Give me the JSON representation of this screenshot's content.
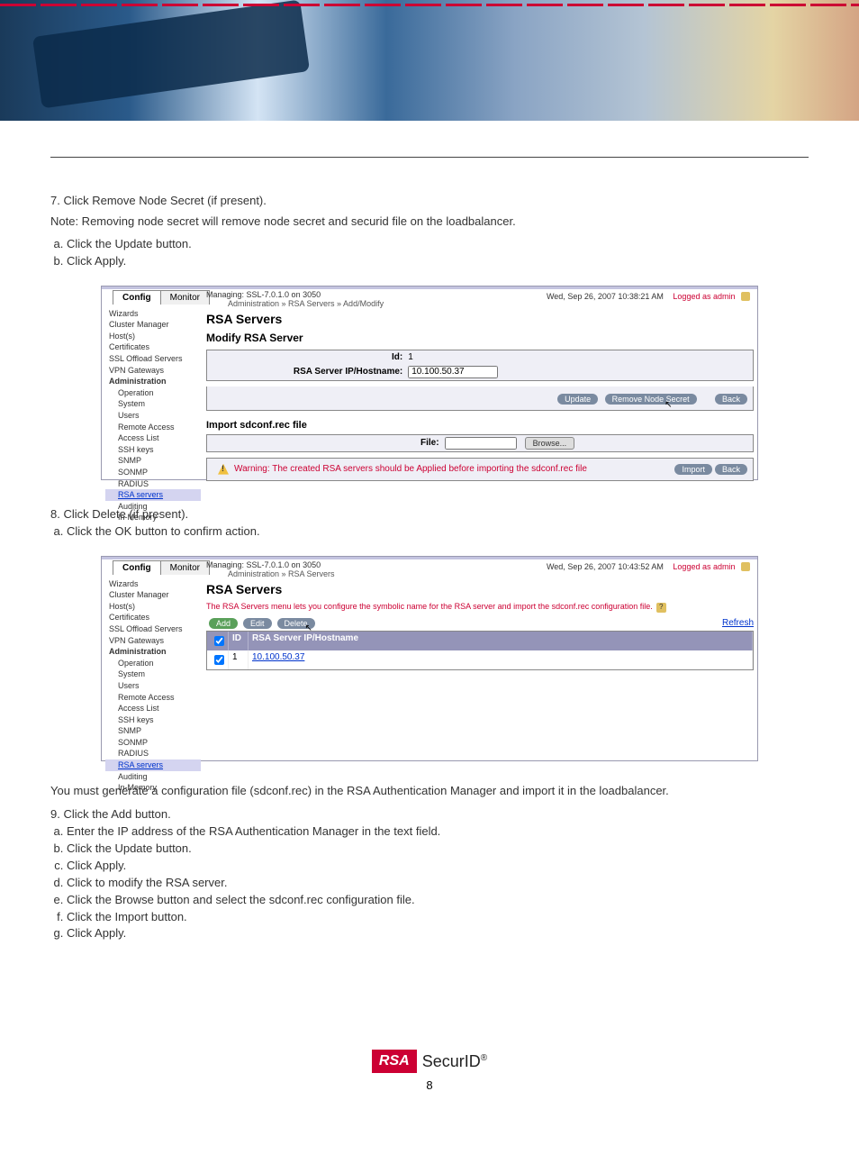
{
  "doc": {
    "step7": "7. Click Remove Node Secret (if present).",
    "note7": "Note: Removing node secret will remove node secret and securid file on the loadbalancer.",
    "list7": [
      "Click the Update button.",
      "Click Apply."
    ],
    "step8": "8. Click Delete (if present).",
    "list8": [
      "Click the OK button to confirm action."
    ],
    "para": "You must generate a configuration file (sdconf.rec) in the RSA Authentication Manager and import it in the loadbalancer.",
    "step9": "9. Click the Add button.",
    "list9": [
      "Enter the IP address of the RSA Authentication Manager in the text field.",
      "Click the Update button.",
      "Click Apply.",
      "Click to modify the RSA server.",
      "Click the Browse button and select the sdconf.rec configuration file.",
      "Click the Import button.",
      "Click Apply."
    ]
  },
  "ui": {
    "tabs": {
      "config": "Config",
      "monitor": "Monitor"
    },
    "nav": {
      "wizards": "Wizards",
      "cluster": "Cluster Manager",
      "hosts": "Host(s)",
      "certs": "Certificates",
      "sslo": "SSL Offload Servers",
      "vpn": "VPN Gateways",
      "admin": "Administration",
      "op": "Operation",
      "sys": "System",
      "users": "Users",
      "ra": "Remote Access",
      "acl": "Access List",
      "ssh": "SSH keys",
      "snmp": "SNMP",
      "sonmp": "SONMP",
      "radius": "RADIUS",
      "rsa": "RSA servers",
      "aud": "Auditing",
      "inmem": "In-Memory"
    },
    "shot1": {
      "mng": "Managing: SSL-7.0.1.0 on 3050",
      "crumb": "Administration  »  RSA Servers  »  Add/Modify",
      "ts": "Wed, Sep 26, 2007 10:38:21 AM",
      "la": "Logged as admin",
      "h1": "RSA Servers",
      "h2": "Modify RSA Server",
      "idlbl": "Id:",
      "idval": "1",
      "iplbl": "RSA Server IP/Hostname:",
      "ipval": "10.100.50.37",
      "btn_update": "Update",
      "btn_remove": "Remove Node Secret",
      "btn_back": "Back",
      "h2b": "Import sdconf.rec file",
      "filelbl": "File:",
      "btn_browse": "Browse...",
      "warn": "Warning: The created RSA servers should be Applied before importing the sdconf.rec file",
      "btn_import": "Import",
      "btn_back2": "Back"
    },
    "shot2": {
      "mng": "Managing: SSL-7.0.1.0 on 3050",
      "crumb": "Administration  »  RSA Servers",
      "ts": "Wed, Sep 26, 2007 10:43:52 AM",
      "la": "Logged as admin",
      "h1": "RSA Servers",
      "intro": "The RSA Servers menu lets you configure the symbolic name for the RSA server and import the sdconf.rec configuration file.",
      "btn_add": "Add",
      "btn_edit": "Edit",
      "btn_del": "Delete",
      "refresh": "Refresh",
      "col_id": "ID",
      "col_ip": "RSA Server IP/Hostname",
      "row_id": "1",
      "row_ip": "10.100.50.37"
    }
  },
  "footer": {
    "brand": "RSA",
    "prod": "SecurID",
    "page": "8"
  }
}
